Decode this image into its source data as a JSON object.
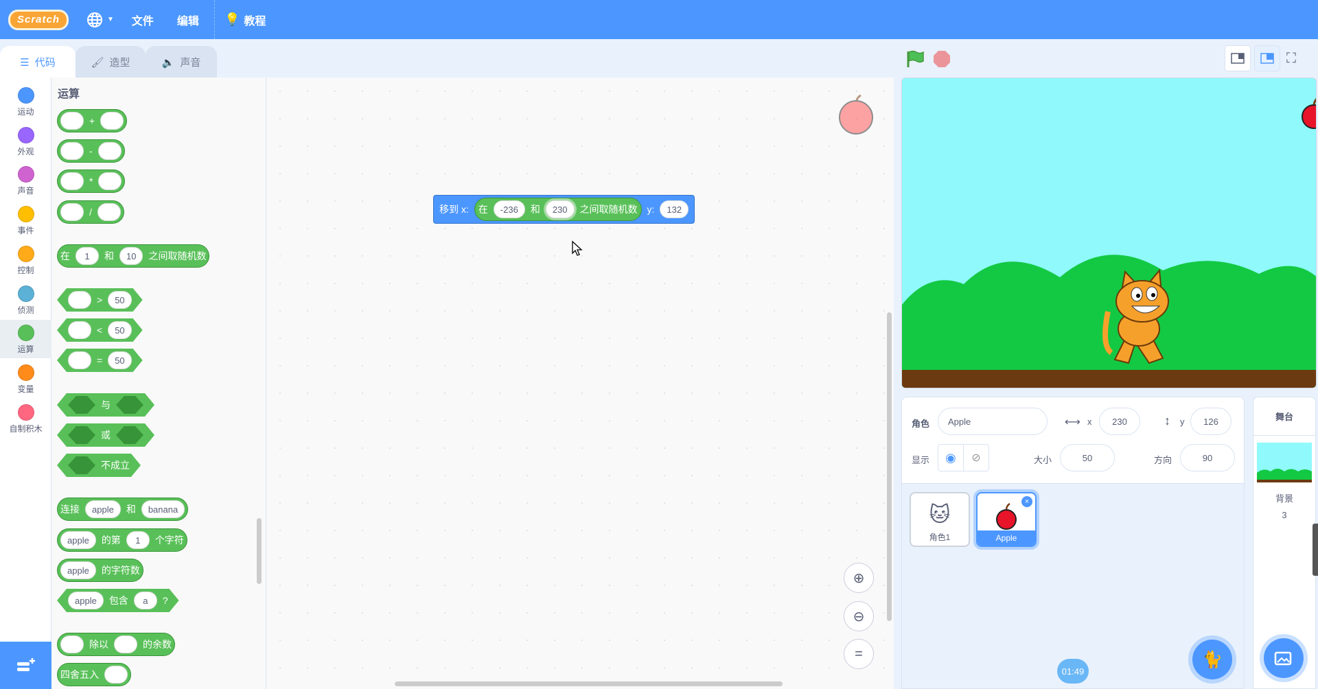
{
  "menu": {
    "logo": "Scratch",
    "file": "文件",
    "edit": "编辑",
    "tutorials": "教程"
  },
  "tabs": {
    "code": "代码",
    "costumes": "造型",
    "sounds": "声音"
  },
  "categories": [
    {
      "label": "运动",
      "color": "#4c97ff"
    },
    {
      "label": "外观",
      "color": "#9966ff"
    },
    {
      "label": "声音",
      "color": "#cf63cf"
    },
    {
      "label": "事件",
      "color": "#ffbf00"
    },
    {
      "label": "控制",
      "color": "#ffab19"
    },
    {
      "label": "侦测",
      "color": "#5cb1d6"
    },
    {
      "label": "运算",
      "color": "#59c059",
      "selected": true
    },
    {
      "label": "变量",
      "color": "#ff8c1a"
    },
    {
      "label": "自制积木",
      "color": "#ff6680"
    }
  ],
  "palette": {
    "title": "运算",
    "blocks": [
      {
        "shape": "round",
        "parts": [
          {
            "i": ""
          },
          {
            "t": "+"
          },
          {
            "i": ""
          }
        ]
      },
      {
        "shape": "round",
        "parts": [
          {
            "i": ""
          },
          {
            "t": "-"
          },
          {
            "i": ""
          }
        ]
      },
      {
        "shape": "round",
        "parts": [
          {
            "i": ""
          },
          {
            "t": "*"
          },
          {
            "i": ""
          }
        ]
      },
      {
        "shape": "round",
        "parts": [
          {
            "i": ""
          },
          {
            "t": "/"
          },
          {
            "i": ""
          }
        ]
      },
      {
        "shape": "round",
        "parts": [
          {
            "t": "在"
          },
          {
            "i": "1"
          },
          {
            "t": "和"
          },
          {
            "i": "10"
          },
          {
            "t": "之间取随机数"
          }
        ]
      },
      {
        "shape": "hex",
        "parts": [
          {
            "i": ""
          },
          {
            "t": ">"
          },
          {
            "i": "50"
          }
        ]
      },
      {
        "shape": "hex",
        "parts": [
          {
            "i": ""
          },
          {
            "t": "<"
          },
          {
            "i": "50"
          }
        ]
      },
      {
        "shape": "hex",
        "parts": [
          {
            "i": ""
          },
          {
            "t": "="
          },
          {
            "i": "50"
          }
        ]
      },
      {
        "shape": "hex",
        "parts": [
          {
            "b": 1
          },
          {
            "t": "与"
          },
          {
            "b": 1
          }
        ]
      },
      {
        "shape": "hex",
        "parts": [
          {
            "b": 1
          },
          {
            "t": "或"
          },
          {
            "b": 1
          }
        ]
      },
      {
        "shape": "hex",
        "parts": [
          {
            "b": 1
          },
          {
            "t": "不成立"
          }
        ]
      },
      {
        "shape": "round",
        "parts": [
          {
            "t": "连接"
          },
          {
            "i": "apple"
          },
          {
            "t": "和"
          },
          {
            "i": "banana"
          }
        ]
      },
      {
        "shape": "round",
        "parts": [
          {
            "i": "apple"
          },
          {
            "t": "的第"
          },
          {
            "i": "1"
          },
          {
            "t": "个字符"
          }
        ]
      },
      {
        "shape": "round",
        "parts": [
          {
            "i": "apple"
          },
          {
            "t": "的字符数"
          }
        ]
      },
      {
        "shape": "hex",
        "parts": [
          {
            "i": "apple"
          },
          {
            "t": "包含"
          },
          {
            "i": "a"
          },
          {
            "t": "?"
          }
        ]
      },
      {
        "shape": "round",
        "parts": [
          {
            "i": ""
          },
          {
            "t": "除以"
          },
          {
            "i": ""
          },
          {
            "t": "的余数"
          }
        ]
      },
      {
        "shape": "round",
        "parts": [
          {
            "t": "四舍五入"
          },
          {
            "i": ""
          }
        ]
      }
    ]
  },
  "script": {
    "goto_label": "移到 x:",
    "random_in": "在",
    "from": "-236",
    "and": "和",
    "to": "230",
    "random_suffix": "之间取随机数",
    "y_label": "y:",
    "y_value": "132"
  },
  "zoom": {
    "in": "+",
    "out": "−",
    "reset": "="
  },
  "sprite_info": {
    "sprite_label": "角色",
    "sprite_name": "Apple",
    "x_label": "x",
    "x": "230",
    "y_label": "y",
    "y": "126",
    "show_label": "显示",
    "size_label": "大小",
    "size": "50",
    "direction_label": "方向",
    "direction": "90"
  },
  "sprites": [
    {
      "name": "角色1",
      "selected": false
    },
    {
      "name": "Apple",
      "selected": true
    }
  ],
  "stage_panel": {
    "title": "舞台",
    "backdrops_label": "背景",
    "backdrops_count": "3"
  },
  "timer": "01:49",
  "colors": {
    "accent": "#4c97ff",
    "operators": "#59c059",
    "operators_dark": "#389438"
  }
}
